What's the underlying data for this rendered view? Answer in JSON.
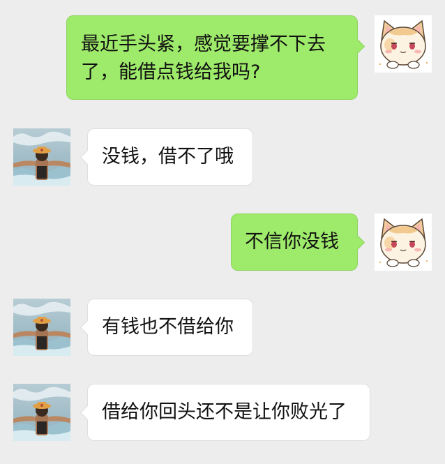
{
  "chat": {
    "messages": [
      {
        "sender": "me",
        "text": "最近手头紧，感觉要撑不下去\n了，能借点钱给我吗?",
        "avatar_icon": "cat-avatar-icon"
      },
      {
        "sender": "friend",
        "text": "没钱，借不了哦",
        "avatar_icon": "pirate-avatar-icon"
      },
      {
        "sender": "me",
        "text": "不信你没钱",
        "avatar_icon": "cat-avatar-icon"
      },
      {
        "sender": "friend",
        "text": "有钱也不借给你",
        "avatar_icon": "pirate-avatar-icon"
      },
      {
        "sender": "friend",
        "text": "借给你回头还不是让你败光了",
        "avatar_icon": "pirate-avatar-icon"
      }
    ]
  },
  "colors": {
    "background": "#ededed",
    "my_bubble": "#9eea6a",
    "friend_bubble": "#ffffff"
  }
}
